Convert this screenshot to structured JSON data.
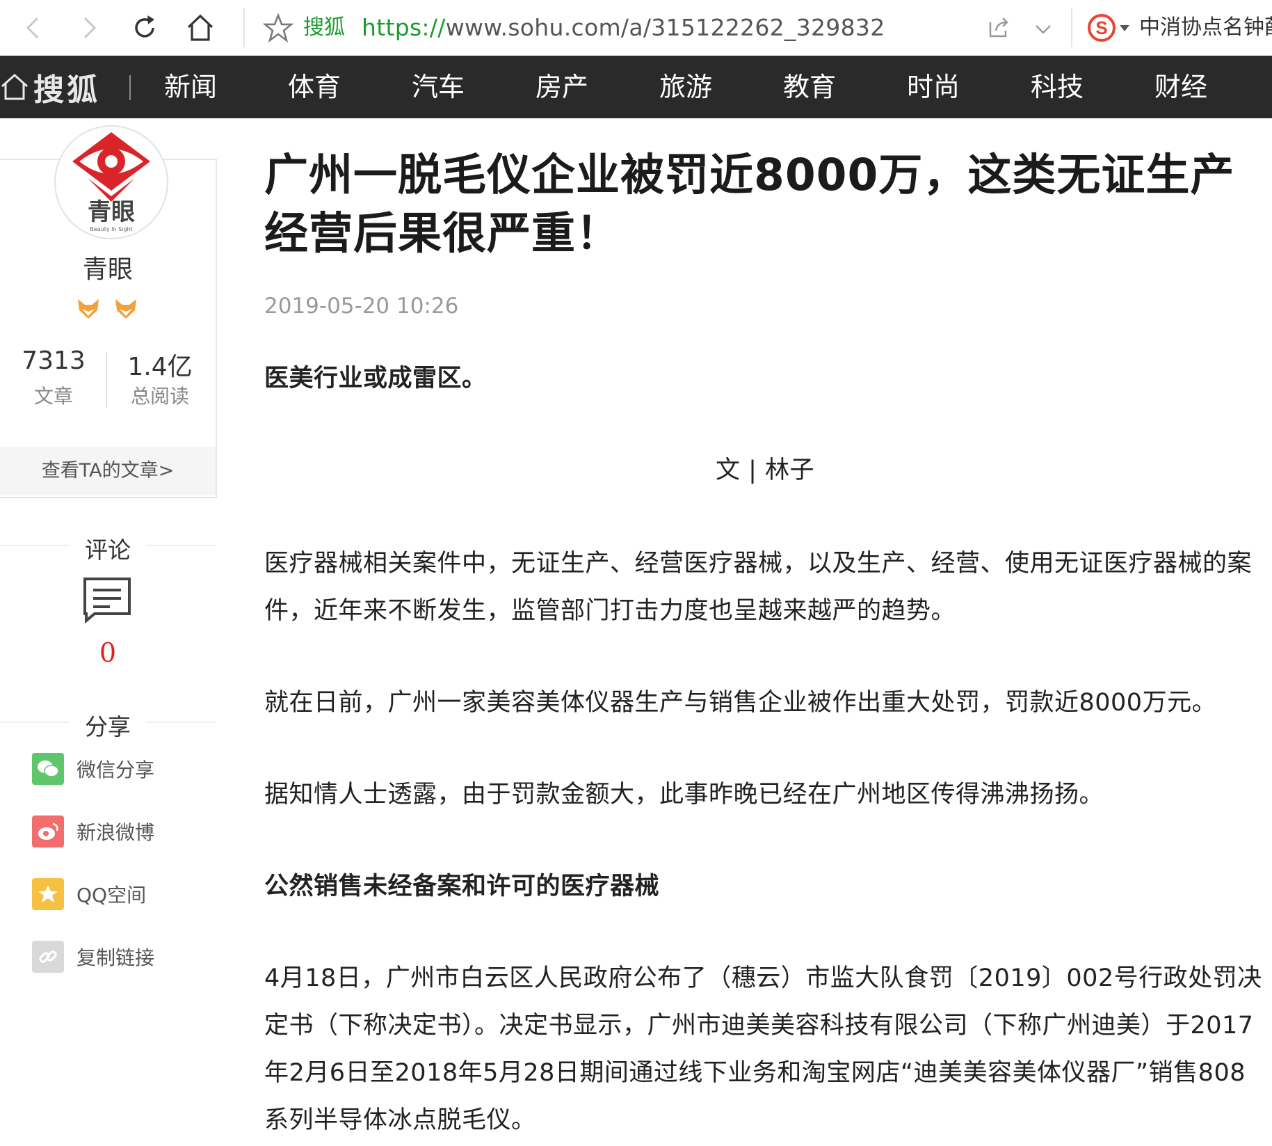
{
  "browser": {
    "site_name": "搜狐",
    "url_protocol": "https://",
    "url_rest": "www.sohu.com/a/315122262_329832",
    "search_hint": "中消协点名钟薛"
  },
  "nav": {
    "logo": "搜狐",
    "items": [
      "新闻",
      "体育",
      "汽车",
      "房产",
      "旅游",
      "教育",
      "时尚",
      "科技",
      "财经"
    ]
  },
  "author": {
    "avatar_text": "青眼",
    "avatar_subtext": "Beauty In Sight",
    "name": "青眼",
    "stats": [
      {
        "value": "7313",
        "label": "文章"
      },
      {
        "value": "1.4亿",
        "label": "总阅读"
      }
    ],
    "view_link": "查看TA的文章>"
  },
  "comments": {
    "title": "评论",
    "count": "0"
  },
  "share": {
    "title": "分享",
    "items": [
      {
        "label": "微信分享",
        "icon": "wechat-icon",
        "color": "#5fc76b"
      },
      {
        "label": "新浪微博",
        "icon": "weibo-icon",
        "color": "#f26d6d"
      },
      {
        "label": "QQ空间",
        "icon": "qzone-icon",
        "color": "#f6c143"
      },
      {
        "label": "复制链接",
        "icon": "link-icon",
        "color": "#d9d9d9"
      }
    ]
  },
  "article": {
    "title": "广州一脱毛仪企业被罚近8000万，这类无证生产经营后果很严重！",
    "time": "2019-05-20 10:26",
    "lead": "医美行业或成雷区。",
    "byline": "文 | 林子",
    "p1": "医疗器械相关案件中，无证生产、经营医疗器械，以及生产、经营、使用无证医疗器械的案件，近年来不断发生，监管部门打击力度也呈越来越严的趋势。",
    "p2": "就在日前，广州一家美容美体仪器生产与销售企业被作出重大处罚，罚款近8000万元。",
    "p3": "据知情人士透露，由于罚款金额大，此事昨晚已经在广州地区传得沸沸扬扬。",
    "h1": "公然销售未经备案和许可的医疗器械",
    "p4": "4月18日，广州市白云区人民政府公布了（穗云）市监大队食罚〔2019〕002号行政处罚决定书（下称决定书）。决定书显示，广州市迪美美容科技有限公司（下称广州迪美）于2017年2月6日至2018年5月28日期间通过线下业务和淘宝网店“迪美美容美体仪器厂”销售808系列半导体冰点脱毛仪。"
  }
}
